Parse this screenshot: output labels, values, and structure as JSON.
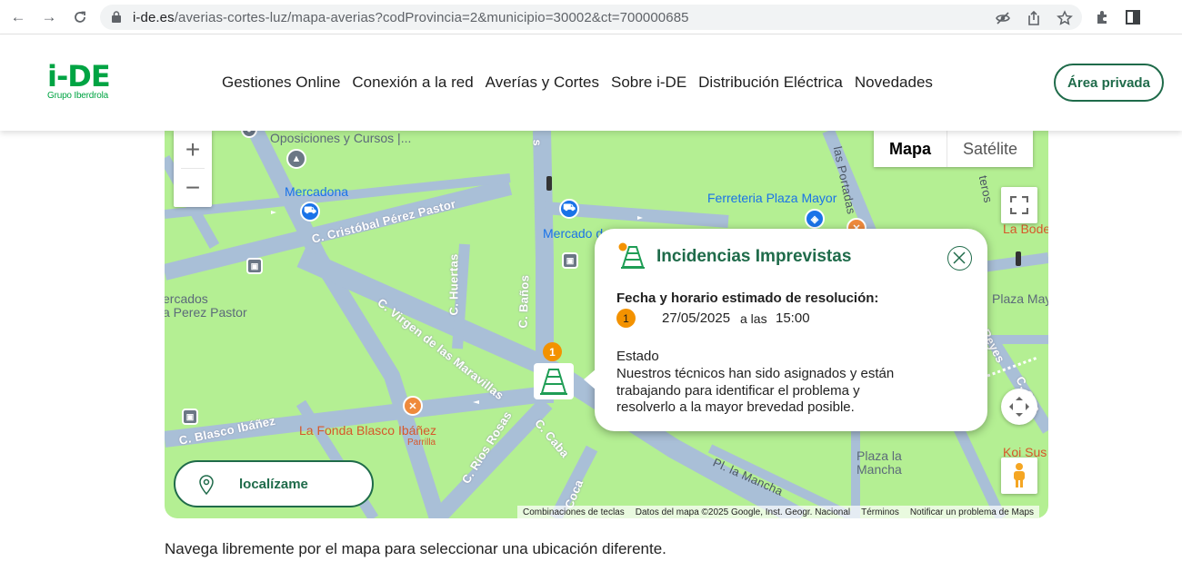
{
  "browser": {
    "url_host": "i-de.es",
    "url_path": "/averias-cortes-luz/mapa-averias?codProvincia=2&municipio=30002&ct=700000685"
  },
  "header": {
    "logo_main": "i-DE",
    "logo_sub": "Grupo Iberdrola",
    "nav": [
      "Gestiones Online",
      "Conexión a la red",
      "Averías y Cortes",
      "Sobre i-DE",
      "Distribución Eléctrica",
      "Novedades"
    ],
    "area_privada": "Área privada"
  },
  "map": {
    "maptype_map": "Mapa",
    "maptype_satellite": "Satélite",
    "streets": [
      "C. Cristóbal Pérez Pastor",
      "C. Huertas",
      "C. Baños",
      "C. Virgen de las Maravillas",
      "C. Blasco Ibáñez",
      "C. Ríos Rosas",
      "C. Caba",
      "Coca",
      "Pl. la Mancha",
      "las Portadas",
      "teros",
      "C. Can",
      "Reyes",
      "s"
    ],
    "pois": {
      "oposiciones": "Oposiciones y Cursos |...",
      "mercadona": "Mercadona",
      "mercado": "Mercado d... M...",
      "ferreteria": "Ferreteria Plaza Mayor",
      "la_bode": "La Bode",
      "plaza_may": "Plaza May",
      "mercados_1": "ercados",
      "mercados_2": "a Perez Pastor",
      "fonda": "La Fonda Blasco Ibáñez",
      "fonda_sub": "Parrilla",
      "plaza_mancha_1": "Plaza la",
      "plaza_mancha_2": "Mancha",
      "koi": "Koi Sus"
    },
    "marker_count": "1",
    "localize_label": "localízame",
    "attribution": [
      "Combinaciones de teclas",
      "Datos del mapa ©2025 Google, Inst. Geogr. Nacional",
      "Términos",
      "Notificar un problema de Maps"
    ]
  },
  "popup": {
    "title": "Incidencias Imprevistas",
    "resolution_heading": "Fecha y horario estimado de resolución:",
    "count": "1",
    "date": "27/05/2025",
    "a_las": "a las",
    "time": "15:00",
    "state_heading": "Estado",
    "state_text": "Nuestros técnicos han sido asignados y están trabajando para identificar el problema y resolverlo a la mayor brevedad posible."
  },
  "footer_text": "Navega libremente por el mapa para seleccionar una ubicación diferente.",
  "colors": {
    "brand_green": "#00a443",
    "dark_green": "#1f6b4a",
    "map_green": "#b4ef93",
    "road": "#a9bfd7",
    "accent_orange": "#f39200"
  }
}
